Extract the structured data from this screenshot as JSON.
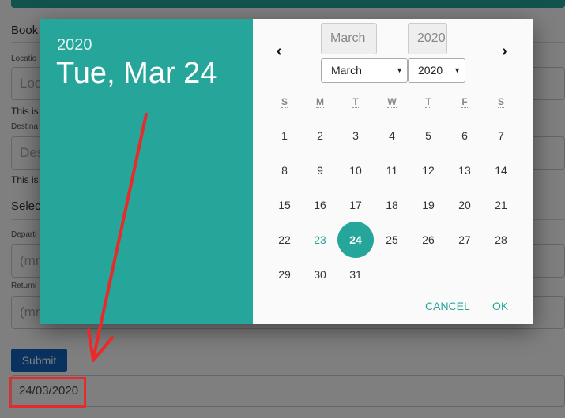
{
  "form": {
    "title": "Book",
    "location_label": "Locatio",
    "location_placeholder": "Loc",
    "location_help": "This is",
    "destination_label": "Destina",
    "destination_placeholder": "Des",
    "destination_help": "This is",
    "section_title": "Select",
    "departure_label": "Departi",
    "departure_placeholder": "(mn",
    "return_label": "Returni",
    "return_placeholder": "(mn",
    "submit_label": "Submit",
    "result_value": "24/03/2020"
  },
  "datepicker": {
    "header_year": "2020",
    "header_date": "Tue, Mar 24",
    "month_box": "March",
    "year_box": "2020",
    "prev_icon": "‹",
    "next_icon": "›",
    "month_select": "March",
    "year_select": "2020",
    "weekdays": [
      "S",
      "M",
      "T",
      "W",
      "T",
      "F",
      "S"
    ],
    "weeks": [
      [
        "1",
        "2",
        "3",
        "4",
        "5",
        "6",
        "7"
      ],
      [
        "8",
        "9",
        "10",
        "11",
        "12",
        "13",
        "14"
      ],
      [
        "15",
        "16",
        "17",
        "18",
        "19",
        "20",
        "21"
      ],
      [
        "22",
        "23",
        "24",
        "25",
        "26",
        "27",
        "28"
      ],
      [
        "29",
        "30",
        "31"
      ]
    ],
    "today": "23",
    "selected": "24",
    "cancel_label": "CANCEL",
    "ok_label": "OK"
  },
  "colors": {
    "accent": "#26a69a",
    "annotation": "#e82a2a",
    "submit": "#1565c0"
  }
}
